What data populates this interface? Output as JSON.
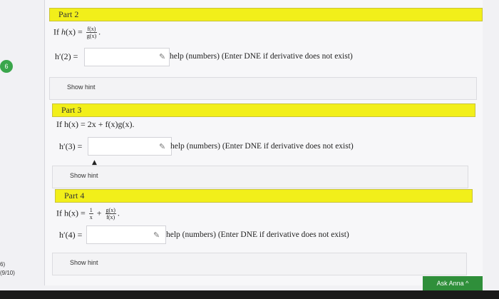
{
  "problem_badge": "6",
  "score_prefix": "6)",
  "score": "(9/10)",
  "parts": [
    {
      "title": "Part 2",
      "eq_prefix": "If ",
      "eq_fn": "h",
      "eq_var": "(x)",
      "eq_eq": " = ",
      "frac_num": "f(x)",
      "frac_den": "g(x)",
      "eq_tail": ".",
      "ask": "h′(2) =",
      "input_value": "",
      "help": "help (numbers) (Enter DNE if derivative does not exist)",
      "hint": "Show hint"
    },
    {
      "title": "Part 3",
      "eq_text": "If h(x) = 2x + f(x)g(x).",
      "ask": "h′(3) =",
      "input_value": "",
      "help": "help (numbers) (Enter DNE if derivative does not exist)",
      "hint": "Show hint"
    },
    {
      "title": "Part 4",
      "eq_prefix": "If h(x) = ",
      "frac1_num": "1",
      "frac1_den": "x",
      "plus": " + ",
      "frac2_num": "g(x)",
      "frac2_den": "f(x)",
      "eq_tail": ".",
      "ask": "h′(4) =",
      "input_value": "",
      "help": "help (numbers) (Enter DNE if derivative does not exist)",
      "hint": "Show hint"
    }
  ],
  "ask_button": "Ask Anna ^",
  "colors": {
    "bar": "#f2ef1a",
    "badge": "#3aa64b",
    "ask_button": "#2f8f3a"
  },
  "icons": {
    "pencil": "pencil-icon"
  }
}
